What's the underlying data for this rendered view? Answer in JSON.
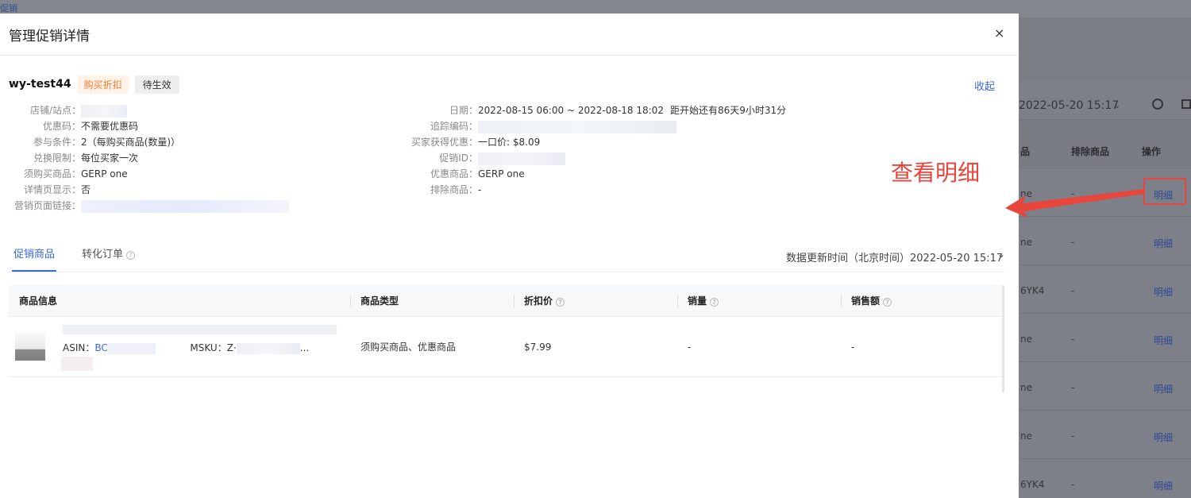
{
  "background": {
    "top_link": "促销",
    "date": "2022-05-20 15:17",
    "headers": {
      "products": "品",
      "exclude": "排除商品",
      "ops": "操作"
    },
    "rows": [
      {
        "product": "ne",
        "exclude": "-",
        "action": "明细"
      },
      {
        "product": "ne",
        "exclude": "-",
        "action": "明细"
      },
      {
        "product": "6YK4",
        "exclude": "-",
        "action": "明细"
      },
      {
        "product": "ne",
        "exclude": "-",
        "action": "明细"
      },
      {
        "product": "ne",
        "exclude": "-",
        "action": "明细"
      },
      {
        "product": "ne",
        "exclude": "-",
        "action": "明细"
      },
      {
        "product": "6YK4",
        "exclude": "-",
        "action": "明细"
      }
    ]
  },
  "modal": {
    "title": "管理促销详情",
    "close": "×",
    "promo_name": "wy-test44",
    "tag_type": "购买折扣",
    "tag_status": "待生效",
    "collapse": "收起",
    "left_info": [
      {
        "label": "店铺/站点：",
        "value": ""
      },
      {
        "label": "优惠码：",
        "value": "不需要优惠码"
      },
      {
        "label": "参与条件：",
        "value": "2（每购买商品(数量)）"
      },
      {
        "label": "兑换限制：",
        "value": "每位买家一次"
      },
      {
        "label": "须购买商品：",
        "value": "GERP one"
      },
      {
        "label": "详情页显示：",
        "value": "否"
      },
      {
        "label": "营销页面链接：",
        "value": ""
      }
    ],
    "right_info": [
      {
        "label": "日期：",
        "value": "2022-08-15 06:00 ~ 2022-08-18 18:02",
        "note": "距开始还有86天9小时31分"
      },
      {
        "label": "追踪编码：",
        "value": ""
      },
      {
        "label": "买家获得优惠：",
        "value": "一口价: $8.09"
      },
      {
        "label": "促销ID：",
        "value": ""
      },
      {
        "label": "优惠商品：",
        "value": "GERP one"
      },
      {
        "label": "排除商品：",
        "value": "-"
      }
    ],
    "tabs": [
      {
        "label": "促销商品"
      },
      {
        "label": "转化订单"
      }
    ],
    "updated": "数据更新时间（北京时间）2022-05-20 15:17",
    "table": {
      "headers": [
        "商品信息",
        "商品类型",
        "折扣价",
        "销量",
        "销售额"
      ],
      "rows": [
        {
          "asin_label": "ASIN：",
          "asin": "BC",
          "msku_label": "MSKU：",
          "msku": "Z·",
          "ellipsis": "...",
          "type": "须购买商品、优惠商品",
          "price": "$7.99",
          "sales": "-",
          "revenue": "-"
        }
      ]
    }
  },
  "annotation": {
    "text": "查看明细"
  }
}
